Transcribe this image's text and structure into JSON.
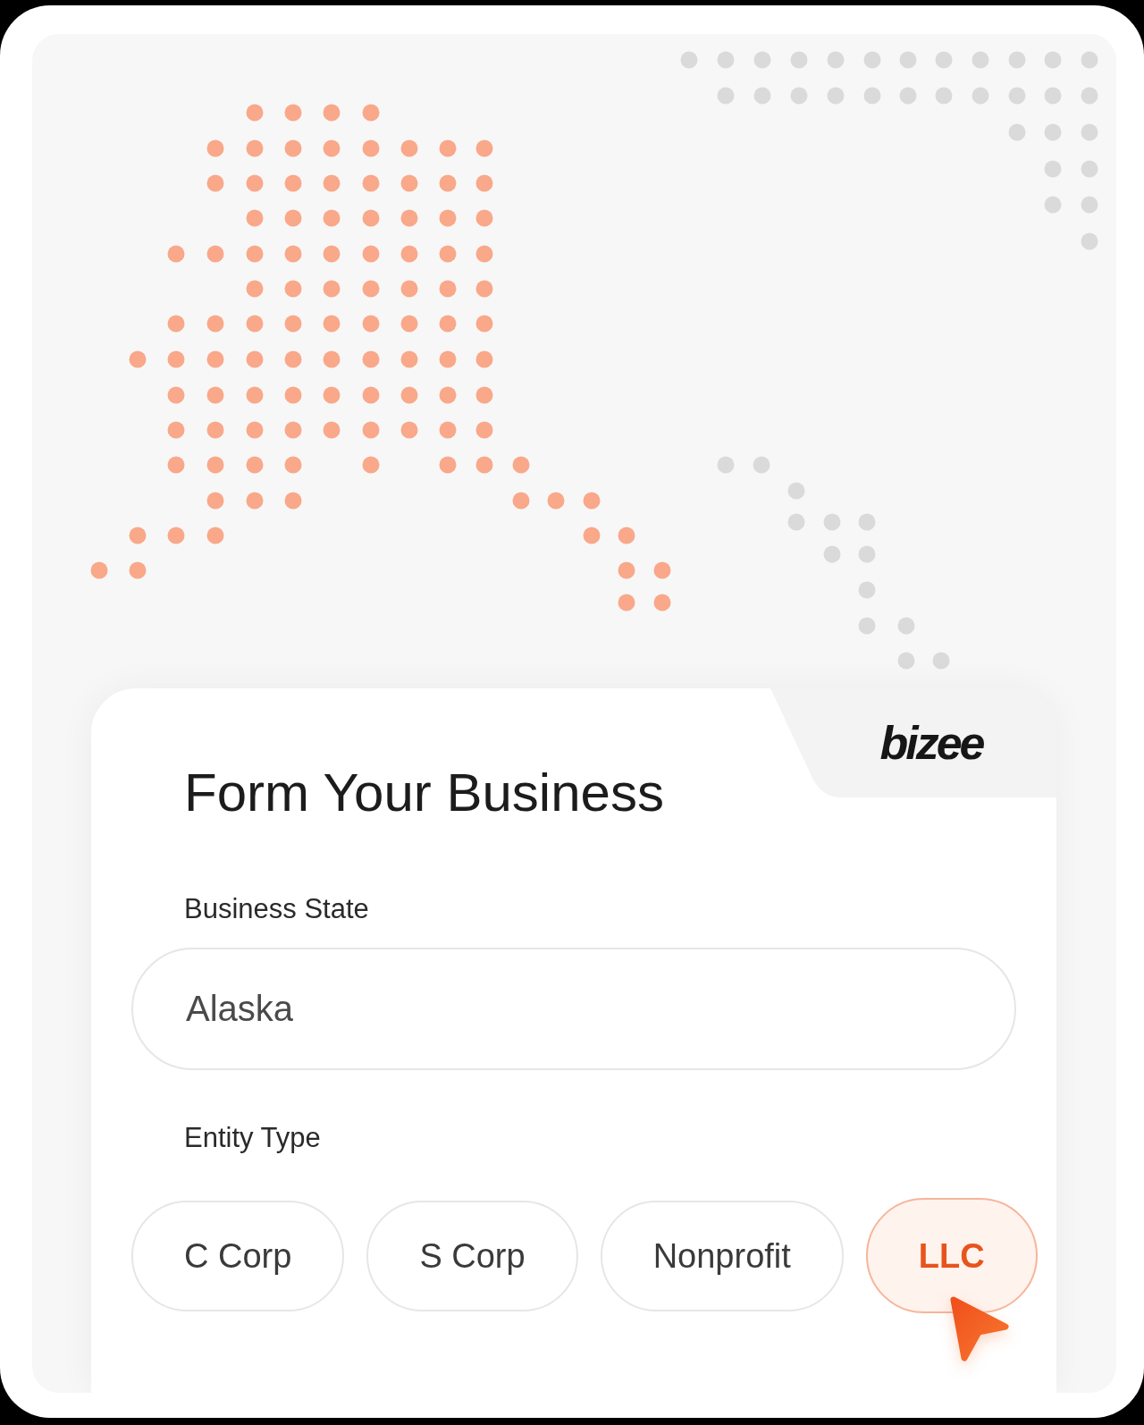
{
  "brand": {
    "logo": "bizee"
  },
  "form": {
    "title": "Form Your Business",
    "state_field": {
      "label": "Business State",
      "value": "Alaska"
    },
    "entity_type": {
      "label": "Entity Type",
      "options": [
        {
          "label": "C Corp",
          "selected": false
        },
        {
          "label": "S Corp",
          "selected": false
        },
        {
          "label": "Nonprofit",
          "selected": false
        },
        {
          "label": "LLC",
          "selected": true
        }
      ]
    }
  }
}
